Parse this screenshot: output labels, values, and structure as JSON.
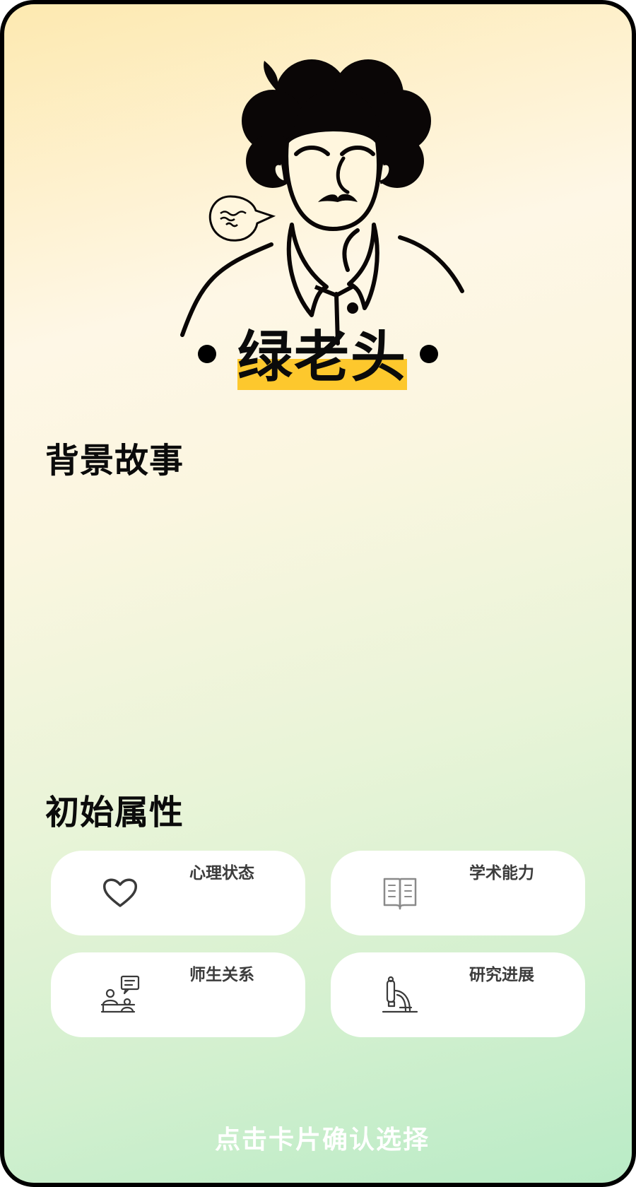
{
  "character": {
    "name": "绿老头",
    "avatar_icon": "old-man-curly-hair-illustration"
  },
  "sections": {
    "background_title": "背景故事",
    "background_text": "",
    "attributes_title": "初始属性"
  },
  "attributes": [
    {
      "label": "心理状态",
      "icon": "heart-icon"
    },
    {
      "label": "学术能力",
      "icon": "book-icon"
    },
    {
      "label": "师生关系",
      "icon": "teacher-student-icon"
    },
    {
      "label": "研究进展",
      "icon": "microscope-icon"
    }
  ],
  "footer": {
    "confirm_label": "点击卡片确认选择"
  },
  "colors": {
    "highlight": "#fdc82d",
    "border": "#000000",
    "gradient_top": "#fde9b0",
    "gradient_bottom": "#b9ebc6"
  }
}
